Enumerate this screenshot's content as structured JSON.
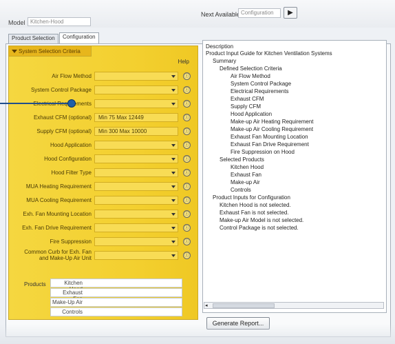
{
  "header": {
    "model_label": "Model",
    "model_value": "Kitchen-Hood",
    "next_available_label": "Next Available",
    "next_available_value": "Configuration",
    "next_button": "▶"
  },
  "tabs": [
    {
      "label": "Product Selection"
    },
    {
      "label": "Configuration",
      "active": true
    }
  ],
  "criteria_section": {
    "title": "System Selection Criteria",
    "help_label": "Help",
    "rows": [
      {
        "label": "Air Flow Method",
        "value": ""
      },
      {
        "label": "System Control Package",
        "value": ""
      },
      {
        "label": "Electrical Requirements",
        "value": ""
      },
      {
        "label": "Exhaust CFM (optional)",
        "value": "Min 75 Max 12449"
      },
      {
        "label": "Supply CFM (optional)",
        "value": "Min 300 Max 10000"
      },
      {
        "label": "Hood Application",
        "value": ""
      },
      {
        "label": "Hood Configuration",
        "value": ""
      },
      {
        "label": "Hood Filter Type",
        "value": ""
      },
      {
        "label": "MUA Heating Requirement",
        "value": ""
      },
      {
        "label": "MUA Cooling Requirement",
        "value": ""
      },
      {
        "label": "Exh. Fan Mounting Location",
        "value": ""
      },
      {
        "label": "Exh. Fan Drive Requirement",
        "value": ""
      },
      {
        "label": "Fire Suppression",
        "value": ""
      },
      {
        "label": "Common Curb for Exh. Fan and Make-Up Air Unit",
        "value": ""
      }
    ],
    "products_label": "Products",
    "products": [
      "Kitchen Hood",
      "Exhaust Fan",
      "Make-Up Air",
      "Controls"
    ]
  },
  "description": {
    "header": "Description",
    "lines": [
      {
        "text": "Product Input Guide for Kitchen Ventilation Systems",
        "indent": 0
      },
      {
        "text": "Summary",
        "indent": 1
      },
      {
        "text": "Defined Selection Criteria",
        "indent": 2
      },
      {
        "text": "Air Flow Method",
        "indent": 3
      },
      {
        "text": "System Control Package",
        "indent": 3
      },
      {
        "text": "Electrical Requirements",
        "indent": 3
      },
      {
        "text": "Exhaust CFM",
        "indent": 3
      },
      {
        "text": "Supply CFM",
        "indent": 3
      },
      {
        "text": "Hood Application",
        "indent": 3
      },
      {
        "text": "Make-up Air Heating Requirement",
        "indent": 3
      },
      {
        "text": "Make-up Air Cooling Requirement",
        "indent": 3
      },
      {
        "text": "Exhaust Fan Mounting Location",
        "indent": 3
      },
      {
        "text": "Exhaust Fan Drive Requirement",
        "indent": 3
      },
      {
        "text": "Fire Suppression on Hood",
        "indent": 3
      },
      {
        "text": "Selected Products",
        "indent": 2
      },
      {
        "text": "Kitchen Hood",
        "indent": 3
      },
      {
        "text": "Exhaust Fan",
        "indent": 3
      },
      {
        "text": "Make-up Air",
        "indent": 3
      },
      {
        "text": "Controls",
        "indent": 3
      },
      {
        "text": "Product Inputs for Configuration",
        "indent": 1
      },
      {
        "text": "Kitchen Hood is not selected.",
        "indent": 2
      },
      {
        "text": "Exhaust Fan is not selected.",
        "indent": 2
      },
      {
        "text": "Make-up Air Model is not selected.",
        "indent": 2
      },
      {
        "text": "Control Package is not selected.",
        "indent": 2
      }
    ]
  },
  "buttons": {
    "generate_report": "Generate Report..."
  },
  "icons": {
    "info": "ⓘ",
    "dropdown": "chevron-down-icon",
    "scroll_left": "◂"
  },
  "colors": {
    "panel_yellow": "#f3cf2e",
    "section_header": "#e7b61c",
    "pointer": "#1f5fa8"
  }
}
